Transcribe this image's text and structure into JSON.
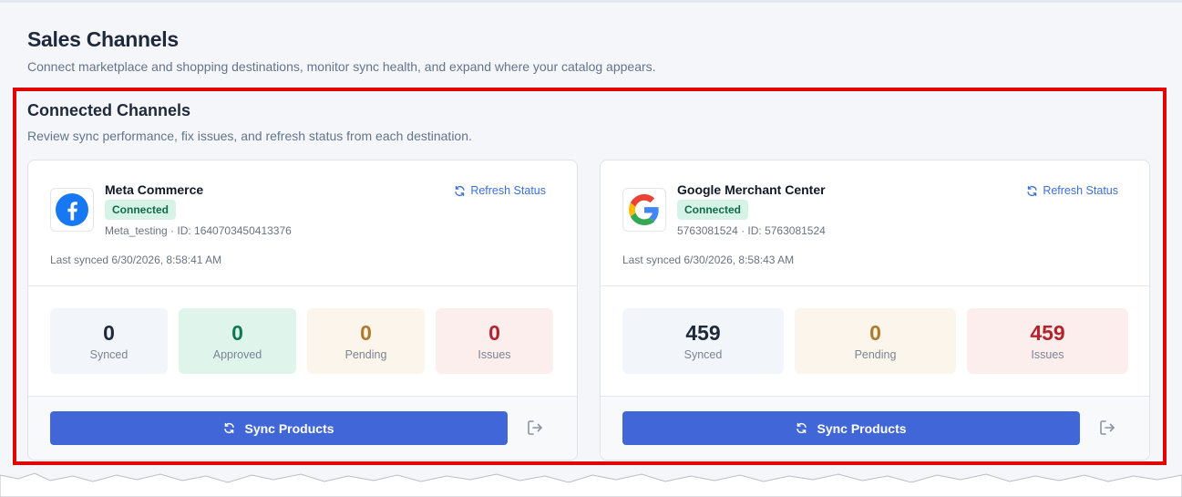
{
  "page": {
    "title": "Sales Channels",
    "subtitle": "Connect marketplace and shopping destinations, monitor sync health, and expand where your catalog appears."
  },
  "section": {
    "title": "Connected Channels",
    "subtitle": "Review sync performance, fix issues, and refresh status from each destination."
  },
  "colors": {
    "highlight_border": "#e10600",
    "primary_button": "#4066d8",
    "connected_badge_bg": "#d7f3e8",
    "connected_badge_text": "#0f6b4b",
    "link": "#3b6fd8"
  },
  "channels": [
    {
      "name": "Meta Commerce",
      "icon": "facebook-logo-icon",
      "status": "Connected",
      "account": "Meta_testing · ID: 1640703450413376",
      "last_synced": "Last synced 6/30/2026, 8:58:41 AM",
      "refresh_label": "Refresh Status",
      "stats": [
        {
          "value": "0",
          "label": "Synced"
        },
        {
          "value": "0",
          "label": "Approved"
        },
        {
          "value": "0",
          "label": "Pending"
        },
        {
          "value": "0",
          "label": "Issues"
        }
      ],
      "sync_label": "Sync Products"
    },
    {
      "name": "Google Merchant Center",
      "icon": "google-logo-icon",
      "status": "Connected",
      "account": "5763081524 · ID: 5763081524",
      "last_synced": "Last synced 6/30/2026, 8:58:43 AM",
      "refresh_label": "Refresh Status",
      "stats": [
        {
          "value": "459",
          "label": "Synced"
        },
        {
          "value": "0",
          "label": "Pending"
        },
        {
          "value": "459",
          "label": "Issues"
        }
      ],
      "sync_label": "Sync Products"
    }
  ]
}
